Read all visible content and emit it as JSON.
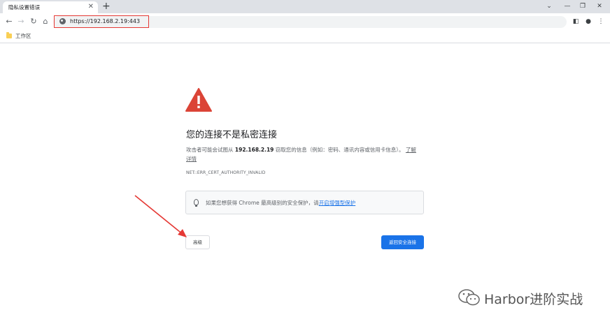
{
  "browser": {
    "tab_title": "隐私设置错误",
    "tab_close": "✕",
    "new_tab": "+",
    "window_controls": [
      "⌄",
      "—",
      "❐",
      "✕"
    ],
    "url": "https://192.168.2.19:443",
    "bookmark_folder": "工作区"
  },
  "page": {
    "heading": "您的连接不是私密连接",
    "desc_prefix": "攻击者可能会试图从 ",
    "host": "192.168.2.19",
    "desc_suffix": " 窃取您的信息（例如：密码、通讯内容或信用卡信息）。",
    "learn_more": "了解详情",
    "error_code": "NET::ERR_CERT_AUTHORITY_INVALID",
    "promo_text": "如果您想获得 Chrome 最高级别的安全保护，请",
    "promo_link": "开启增强型保护",
    "advanced_button": "高级",
    "back_button": "返回安全连接"
  },
  "watermark": {
    "text": "Harbor进阶实战"
  },
  "colors": {
    "warning": "#db4437",
    "primary": "#1a73e8",
    "annotation": "#e53935"
  }
}
